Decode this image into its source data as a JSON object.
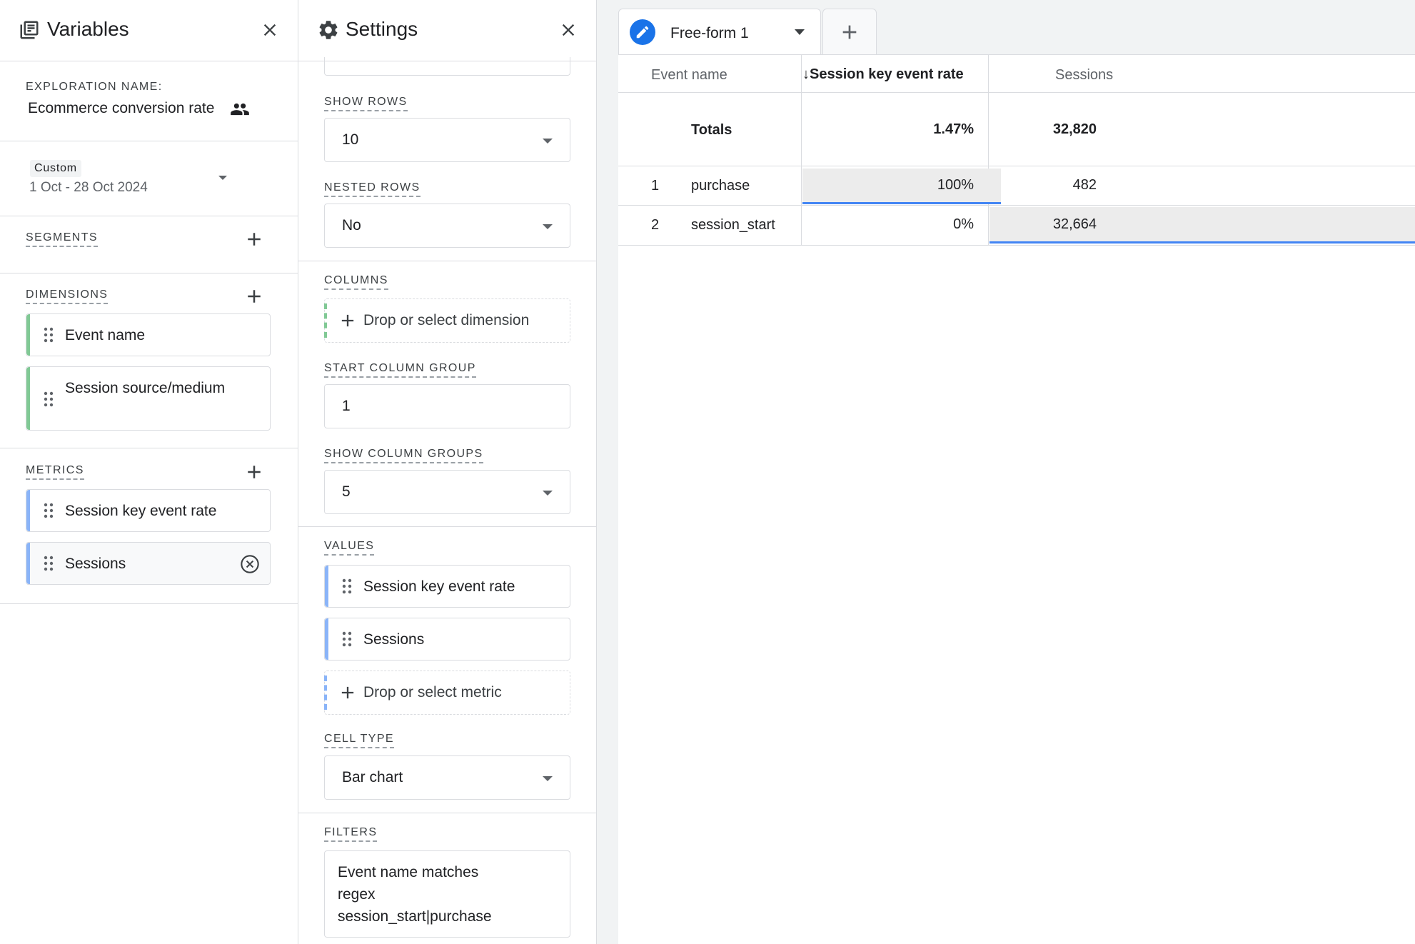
{
  "variables": {
    "title": "Variables",
    "exploration_label": "EXPLORATION NAME:",
    "exploration_name": "Ecommerce conversion rate",
    "date_range": {
      "badge": "Custom",
      "range": "1 Oct - 28 Oct 2024"
    },
    "segments": {
      "label": "SEGMENTS"
    },
    "dimensions": {
      "label": "DIMENSIONS",
      "items": [
        "Event name",
        "Session source/medium"
      ]
    },
    "metrics": {
      "label": "METRICS",
      "items": [
        "Session key event rate",
        "Sessions"
      ]
    }
  },
  "settings": {
    "title": "Settings",
    "show_rows": {
      "label": "SHOW ROWS",
      "value": "10"
    },
    "nested_rows": {
      "label": "NESTED ROWS",
      "value": "No"
    },
    "columns": {
      "label": "COLUMNS",
      "placeholder": "Drop or select dimension"
    },
    "start_column_group": {
      "label": "START COLUMN GROUP",
      "value": "1"
    },
    "show_column_groups": {
      "label": "SHOW COLUMN GROUPS",
      "value": "5"
    },
    "values": {
      "label": "VALUES",
      "items": [
        "Session key event rate",
        "Sessions"
      ],
      "placeholder": "Drop or select metric"
    },
    "cell_type": {
      "label": "CELL TYPE",
      "value": "Bar chart"
    },
    "filters": {
      "label": "FILTERS",
      "text_lines": [
        "Event name matches",
        "regex",
        "session_start|purchase"
      ]
    }
  },
  "tabs": {
    "active": "Free-form 1"
  },
  "table": {
    "headers": {
      "dimension": "Event name",
      "metric1": "Session key event rate",
      "metric2": "Sessions",
      "sort_arrow": "↓"
    },
    "totals": {
      "label": "Totals",
      "metric1": "1.47%",
      "metric2": "32,820"
    },
    "rows": [
      {
        "index": "1",
        "name": "purchase",
        "metric1": "100%",
        "metric2": "482",
        "metric1_fill": 1.0,
        "metric2_fill": 0.0
      },
      {
        "index": "2",
        "name": "session_start",
        "metric1": "0%",
        "metric2": "32,664",
        "metric1_fill": 0.0,
        "metric2_fill": 1.0
      }
    ]
  },
  "colors": {
    "dimension_accent": "#81c995",
    "metric_accent": "#8ab4f8",
    "primary_blue": "#1a73e8",
    "bar_fill": "#e8eaed"
  },
  "icons": {
    "variables": "library-books-icon",
    "settings": "gear-icon",
    "close": "close-icon",
    "shared": "people-icon",
    "add": "plus-icon",
    "drag": "drag-handle-icon",
    "remove": "cancel-circle-icon",
    "edit": "pencil-icon",
    "dropdown": "caret-down-icon"
  }
}
